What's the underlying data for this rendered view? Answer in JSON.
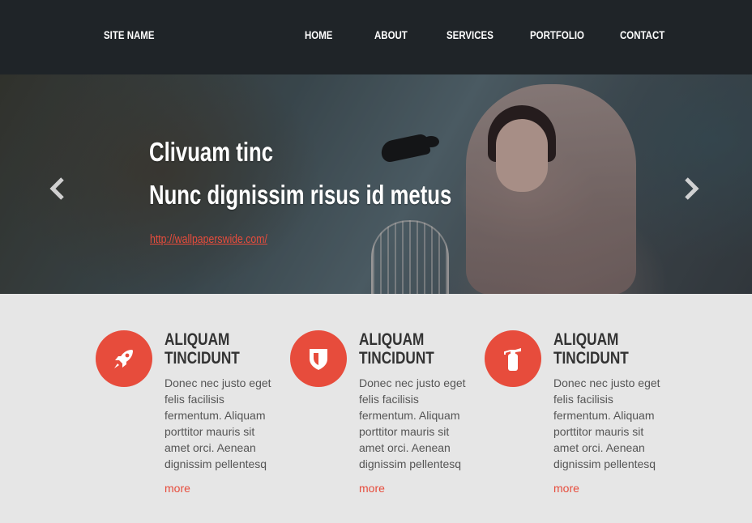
{
  "header": {
    "site_name": "SITE NAME",
    "nav": [
      "HOME",
      "ABOUT",
      "SERVICES",
      "PORTFOLIO",
      "CONTACT"
    ]
  },
  "hero": {
    "title_line1": "Clivuam tinc",
    "title_line2": "Nunc dignissim risus id metus",
    "link": "http://wallpaperswide.com/",
    "prev_icon": "chevron-left-icon",
    "next_icon": "chevron-right-icon"
  },
  "features": [
    {
      "icon": "rocket-icon",
      "title_lines": [
        "ALIQUAM",
        "TINCIDUNT"
      ],
      "text_lines": [
        "Donec nec justo eget",
        "felis facilisis",
        "fermentum. Aliquam",
        "porttitor mauris sit",
        "amet orci. Aenean",
        "dignissim pellentesq"
      ],
      "more": "more"
    },
    {
      "icon": "shield-icon",
      "title_lines": [
        "ALIQUAM",
        "TINCIDUNT"
      ],
      "text_lines": [
        "Donec nec justo eget",
        "felis facilisis",
        "fermentum. Aliquam",
        "porttitor mauris sit",
        "amet orci. Aenean",
        "dignissim pellentesq"
      ],
      "more": "more"
    },
    {
      "icon": "fire-extinguisher-icon",
      "title_lines": [
        "ALIQUAM",
        "TINCIDUNT"
      ],
      "text_lines": [
        "Donec nec justo eget",
        "felis facilisis",
        "fermentum. Aliquam",
        "porttitor mauris sit",
        "amet orci. Aenean",
        "dignissim pellentesq"
      ],
      "more": "more"
    }
  ],
  "colors": {
    "accent": "#e74c3c",
    "header_bg": "#1f2428",
    "features_bg": "#e6e6e6"
  }
}
